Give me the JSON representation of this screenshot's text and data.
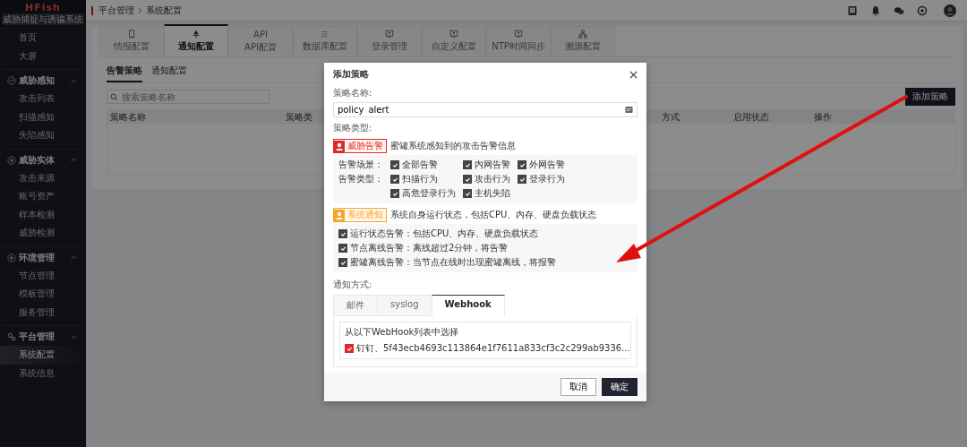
{
  "logo": {
    "title": "HFish",
    "subtitle": "威胁捕捉与诱骗系统"
  },
  "breadcrumb": [
    "平台管理",
    "系统配置"
  ],
  "sidebar": {
    "sections": [
      {
        "items": [
          {
            "label": "首页",
            "selected": false
          },
          {
            "label": "大屏",
            "selected": false
          }
        ]
      },
      {
        "title": "威胁感知",
        "expanded": true,
        "items": [
          {
            "label": "攻击列表",
            "selected": false
          },
          {
            "label": "扫描感知",
            "selected": false
          },
          {
            "label": "失陷感知",
            "selected": false
          }
        ]
      },
      {
        "title": "威胁实体",
        "expanded": true,
        "items": [
          {
            "label": "攻击来源",
            "selected": false
          },
          {
            "label": "账号资产",
            "selected": false
          },
          {
            "label": "样本检测",
            "selected": false
          },
          {
            "label": "威胁检测",
            "selected": false
          }
        ]
      },
      {
        "title": "环境管理",
        "expanded": true,
        "items": [
          {
            "label": "节点管理",
            "selected": false
          },
          {
            "label": "模板管理",
            "selected": false
          },
          {
            "label": "服务管理",
            "selected": false
          }
        ]
      },
      {
        "title": "平台管理",
        "expanded": true,
        "items": [
          {
            "label": "系统配置",
            "selected": true
          },
          {
            "label": "系统信息",
            "selected": false
          }
        ]
      }
    ]
  },
  "tabs": [
    {
      "label": "情报配置",
      "selected": false
    },
    {
      "label": "通知配置",
      "selected": true
    },
    {
      "label": "API配置",
      "icon_text": "API",
      "selected": false
    },
    {
      "label": "数据库配置",
      "selected": false
    },
    {
      "label": "登录管理",
      "selected": false
    },
    {
      "label": "自定义配置",
      "selected": false
    },
    {
      "label": "NTP时间同步",
      "selected": false
    },
    {
      "label": "溯源配置",
      "selected": false
    }
  ],
  "subtabs": [
    {
      "label": "告警策略",
      "selected": true
    },
    {
      "label": "通知配置",
      "selected": false
    }
  ],
  "search": {
    "placeholder": "搜索策略名称"
  },
  "add_button": "添加策略",
  "table": {
    "columns": [
      "策略名称",
      "策略类",
      "方式",
      "启用状态",
      "操作"
    ]
  },
  "modal": {
    "title": "添加策略",
    "name_label": "策略名称:",
    "name_value": "policy_alert",
    "type_label": "策略类型:",
    "groups": [
      {
        "tag": "威胁告警",
        "color": "#e0282c",
        "description": "蜜罐系统感知到的攻击告警信息",
        "kind": "grid",
        "rows": [
          {
            "label": "告警场景：",
            "options": [
              {
                "label": "全部告警",
                "checked": true
              },
              {
                "label": "内网告警",
                "checked": true
              },
              {
                "label": "外网告警",
                "checked": true
              }
            ]
          },
          {
            "label": "告警类型：",
            "options": [
              {
                "label": "扫描行为",
                "checked": true
              },
              {
                "label": "攻击行为",
                "checked": true
              },
              {
                "label": "登录行为",
                "checked": true
              }
            ]
          },
          {
            "options": [
              {
                "label": "高危登录行为",
                "checked": true
              },
              {
                "label": "主机失陷",
                "checked": true
              }
            ]
          }
        ]
      },
      {
        "tag": "系统通知",
        "color": "#f5a623",
        "description": "系统自身运行状态，包括CPU、内存、硬盘负载状态",
        "kind": "list",
        "rows": [
          {
            "options": [
              {
                "label": "运行状态告警：包括CPU、内存、硬盘负载状态",
                "checked": true
              }
            ]
          },
          {
            "options": [
              {
                "label": "节点离线告警：离线超过2分钟，将告警",
                "checked": true
              }
            ]
          },
          {
            "options": [
              {
                "label": "蜜罐离线告警：当节点在线时出现蜜罐离线，将报警",
                "checked": true
              }
            ]
          }
        ]
      }
    ],
    "notify_label": "通知方式:",
    "notify_tabs": [
      {
        "label": "邮件",
        "selected": false
      },
      {
        "label": "syslog",
        "selected": false
      },
      {
        "label": "Webhook",
        "selected": true
      }
    ],
    "webhook_hint": "从以下WebHook列表中选择",
    "webhooks": [
      {
        "label": "钉钉、5f43ecb4693c113864e1f7611a833cf3c2c299ab9336...",
        "checked": true
      }
    ],
    "cancel": "取消",
    "confirm": "确定"
  }
}
